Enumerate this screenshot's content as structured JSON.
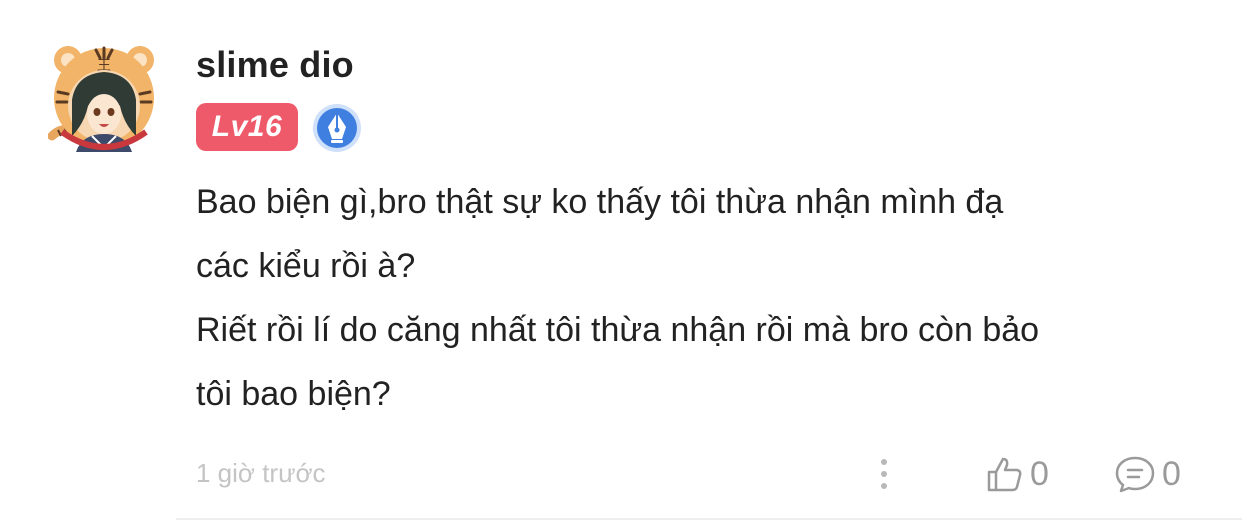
{
  "comment": {
    "user": {
      "name": "slime dio",
      "level": "Lv16"
    },
    "content": [
      "Bao biện gì,bro thật sự ko thấy tôi thừa nhận mình đạ",
      "các kiểu rồi à?",
      "Riết rồi lí do căng nhất tôi thừa nhận rồi mà bro còn bảo",
      "tôi bao biện?"
    ],
    "timestamp": "1 giờ trước",
    "actions": {
      "like_count": "0",
      "reply_count": "0"
    }
  },
  "icons": {
    "avatar": "tiger-hat-avatar",
    "badge": "fountain-pen-badge-icon",
    "more": "vertical-dots-icon",
    "like": "thumbs-up-icon",
    "reply": "speech-bubble-icon"
  },
  "colors": {
    "level_badge": "#ee5a6a",
    "pen_badge": "#3f7fe0",
    "text": "#222222",
    "muted": "#9a9a9a",
    "timestamp": "#c4c4c4"
  }
}
